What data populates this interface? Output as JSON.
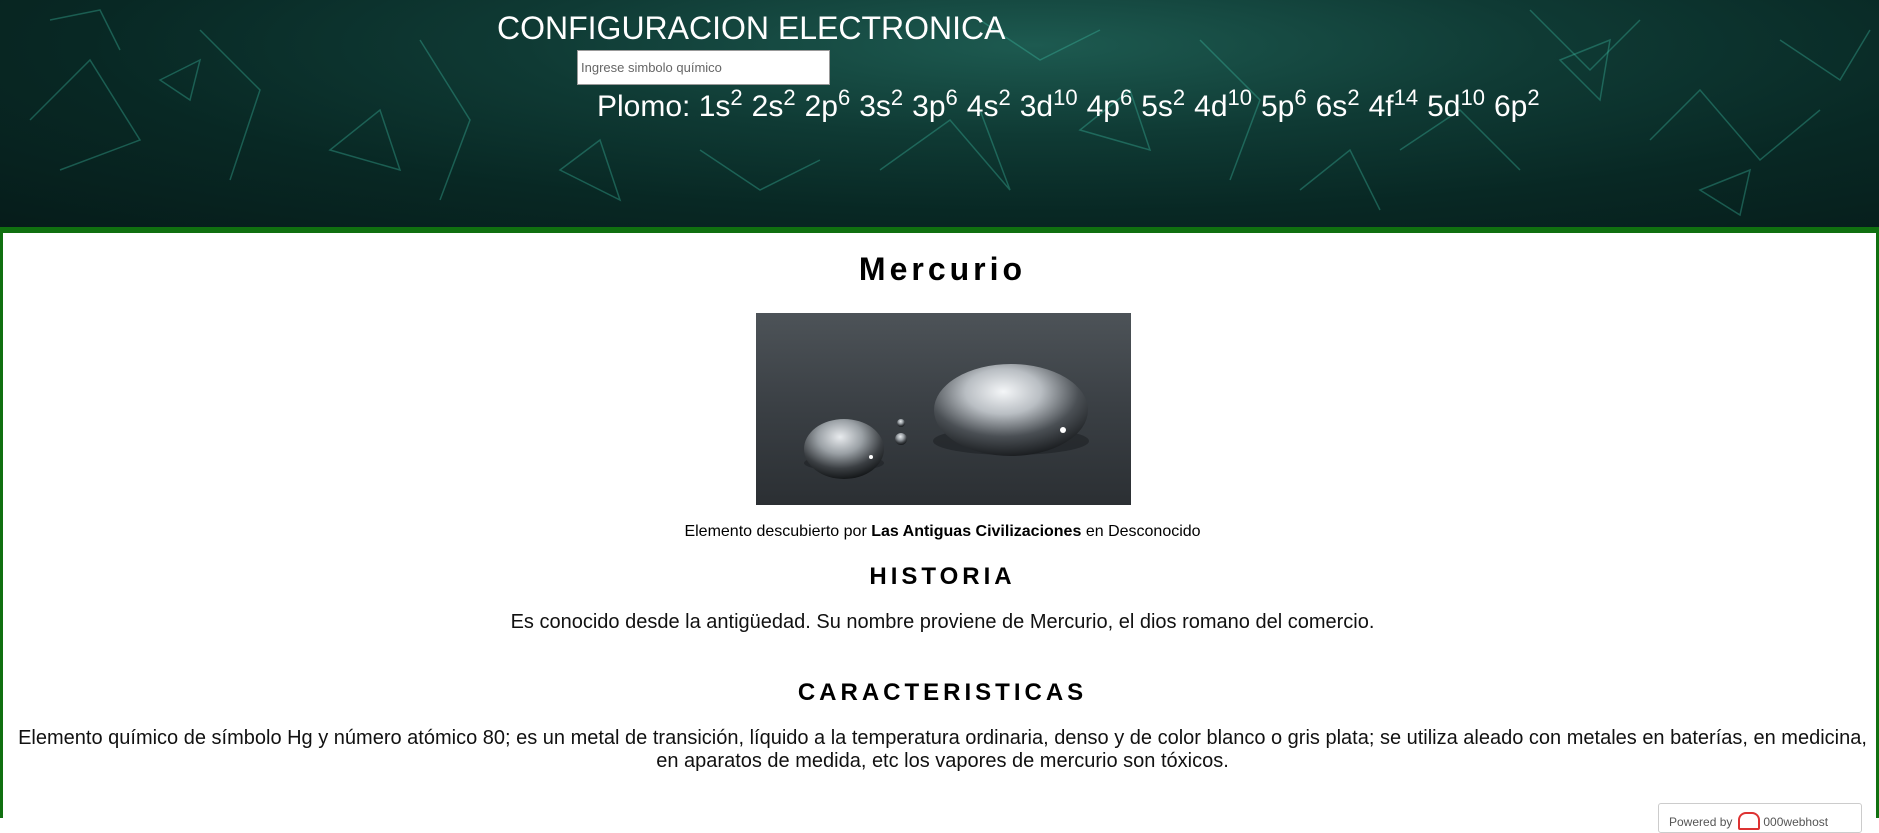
{
  "header": {
    "title": "CONFIGURACION ELECTRONICA",
    "search_placeholder": "Ingrese simbolo químico",
    "search_value": "",
    "config_label": "Plomo:",
    "orbitals": [
      {
        "o": "1s",
        "e": "2"
      },
      {
        "o": "2s",
        "e": "2"
      },
      {
        "o": "2p",
        "e": "6"
      },
      {
        "o": "3s",
        "e": "2"
      },
      {
        "o": "3p",
        "e": "6"
      },
      {
        "o": "4s",
        "e": "2"
      },
      {
        "o": "3d",
        "e": "10"
      },
      {
        "o": "4p",
        "e": "6"
      },
      {
        "o": "5s",
        "e": "2"
      },
      {
        "o": "4d",
        "e": "10"
      },
      {
        "o": "5p",
        "e": "6"
      },
      {
        "o": "6s",
        "e": "2"
      },
      {
        "o": "4f",
        "e": "14"
      },
      {
        "o": "5d",
        "e": "10"
      },
      {
        "o": "6p",
        "e": "2"
      }
    ]
  },
  "element": {
    "name": "Mercurio",
    "discovered_prefix": "Elemento descubierto por",
    "discovered_by": "Las Antiguas Civilizaciones",
    "discovered_mid": "en",
    "discovered_when": "Desconocido"
  },
  "history": {
    "title": "HISTORIA",
    "text": "Es conocido desde la antigüedad. Su nombre proviene de Mercurio, el dios romano del comercio."
  },
  "characteristics": {
    "title": "CARACTERISTICAS",
    "text": "Elemento químico de símbolo Hg y número atómico 80; es un metal de transición, líquido a la temperatura ordinaria, denso y de color blanco o gris plata; se utiliza aleado con metales en baterías, en medicina, en aparatos de medida, etc los vapores de mercurio son tóxicos."
  },
  "badge": {
    "powered_by": "Powered by",
    "host": "000webhost"
  },
  "colors": {
    "header_bg": "#0b2f2b",
    "border_green": "#107010"
  },
  "icons": {
    "badge_logo": "webhost-logo-icon"
  }
}
